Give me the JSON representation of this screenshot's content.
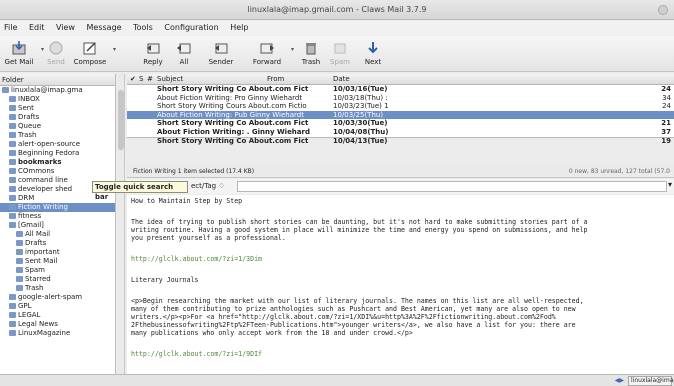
{
  "window": {
    "title": "linuxlala@imap.gmail.com - Claws Mail 3.7.9"
  },
  "menubar": {
    "items": [
      "File",
      "Edit",
      "View",
      "Message",
      "Tools",
      "Configuration",
      "Help"
    ]
  },
  "toolbar": {
    "get_mail": "Get Mail",
    "send": "Send",
    "compose": "Compose",
    "reply": "Reply",
    "all": "All",
    "sender": "Sender",
    "forward": "Forward",
    "trash": "Trash",
    "spam": "Spam",
    "next": "Next"
  },
  "folders": {
    "header": "Folder",
    "items": [
      {
        "label": "linuxlala@imap.gma",
        "level": 0
      },
      {
        "label": "INBOX",
        "level": 1
      },
      {
        "label": "Sent",
        "level": 1
      },
      {
        "label": "Drafts",
        "level": 1
      },
      {
        "label": "Queue",
        "level": 1
      },
      {
        "label": "Trash",
        "level": 1
      },
      {
        "label": "alert-open-source",
        "level": 1
      },
      {
        "label": "Beginning Fedora",
        "level": 1
      },
      {
        "label": "bookmarks",
        "level": 1
      },
      {
        "label": "COmmons",
        "level": 1
      },
      {
        "label": "command line",
        "level": 1
      },
      {
        "label": "developer shed",
        "level": 1
      },
      {
        "label": "DRM",
        "level": 1
      },
      {
        "label": "Fiction Writing",
        "level": 1
      },
      {
        "label": "fitness",
        "level": 1
      },
      {
        "label": "[Gmail]",
        "level": 1
      },
      {
        "label": "All Mail",
        "level": 2
      },
      {
        "label": "Drafts",
        "level": 2
      },
      {
        "label": "important",
        "level": 2
      },
      {
        "label": "Sent Mail",
        "level": 2
      },
      {
        "label": "Spam",
        "level": 2
      },
      {
        "label": "Starred",
        "level": 2
      },
      {
        "label": "Trash",
        "level": 2
      },
      {
        "label": "google-alert-spam",
        "level": 1
      },
      {
        "label": "GPL",
        "level": 1
      },
      {
        "label": "LEGAL",
        "level": 1
      },
      {
        "label": "Legal News",
        "level": 1
      },
      {
        "label": "LinuxMagazine",
        "level": 1
      }
    ]
  },
  "messages": {
    "columns": {
      "check": "✔",
      "s": "S",
      "num": "#",
      "subject": "Subject",
      "from": "From",
      "date": "Date"
    },
    "rows": [
      {
        "subject": "Short Story Writing Co About.com Fict",
        "date": "10/03/16(Tue)",
        "size": "24",
        "bold": true
      },
      {
        "subject": "About Fiction Writing: Pro Ginny Wiehardt",
        "date": "10/03/18(Thu) :",
        "size": "34",
        "bold": false
      },
      {
        "subject": "Short Story Writing Cours About.com Fictio",
        "date": "10/03/23(Tue) 1",
        "size": "24",
        "bold": false
      },
      {
        "subject": "About Fiction Writing: Pub Ginny Wiehardt",
        "date": "10/03/25(Thu)",
        "size": "",
        "bold": false
      },
      {
        "subject": "Short Story Writing Co About.com Fict",
        "date": "10/03/30(Tue)",
        "size": "21",
        "bold": true
      },
      {
        "subject": "About Fiction Writing: . Ginny Wiehard",
        "date": "10/04/08(Thu)",
        "size": "37",
        "bold": true
      },
      {
        "subject": "Short Story Writing Co About.com Fict",
        "date": "10/04/13(Tue)",
        "size": "19",
        "bold": true
      }
    ]
  },
  "infobar": {
    "left": "Fiction Writing  1 item selected (17.4 KB)",
    "right": "0 new, 83 unread, 127 total (57.0"
  },
  "quicksearch": {
    "tooltip": "Toggle quick search bar",
    "label": "ect/Tag ♢"
  },
  "message_body": {
    "line0": "How to Maintain Step by Step",
    "para1a": "The idea of trying to publish short stories can be daunting, but it's not hard to make submitting stories part of a",
    "para1b": "writing routine. Having a good system in place will minimize the time and energy you spend on submissions, and help",
    "para1c": "you present yourself as a professional.",
    "url1": "http://glclk.about.com/?zi=1/3Dim",
    "heading": "Literary Journals",
    "para2a": "<p>Begin researching the market with our list of literary journals. The names on this list are all well-respected,",
    "para2b": "many of them contributing to prize anthologies such as Pushcart and Best American, yet many are also open to new",
    "para2c": "writers.</p><p>For <a href=\"http://glclk.about.com/?zi=1/XDI%&u=http%3A%2F%2Ffictionwriting.about.com%2Fod%",
    "para2d": "2Fthebusinessofwriting%2Ftp%2FTeen-Publications.htm\">younger writers</a>, we also have a list for you: there are",
    "para2e": "many publications who only accept work from the 18 and under crowd.</p>",
    "url2": "http://glclk.about.com/?zi=1/9DIf"
  },
  "statusbar": {
    "account": "linuxlala@imap"
  }
}
